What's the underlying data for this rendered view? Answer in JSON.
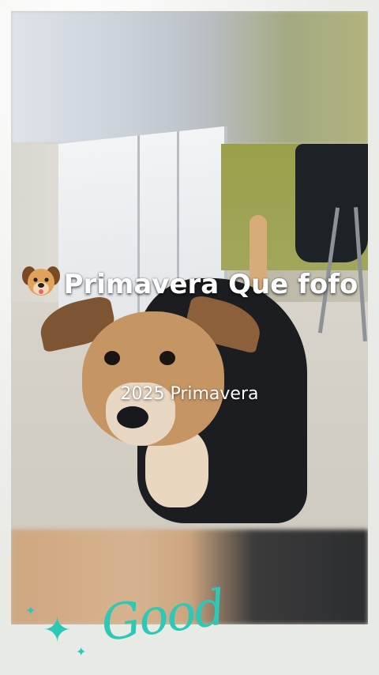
{
  "overlay": {
    "title": "Primavera Que fofo",
    "subtitle": "2025 Primavera"
  },
  "decoration": {
    "script_text": "Good",
    "sparkle_glyph": "✦",
    "accent_color": "#2ec8b6"
  },
  "icons": {
    "title_icon": "dog-face-icon"
  }
}
